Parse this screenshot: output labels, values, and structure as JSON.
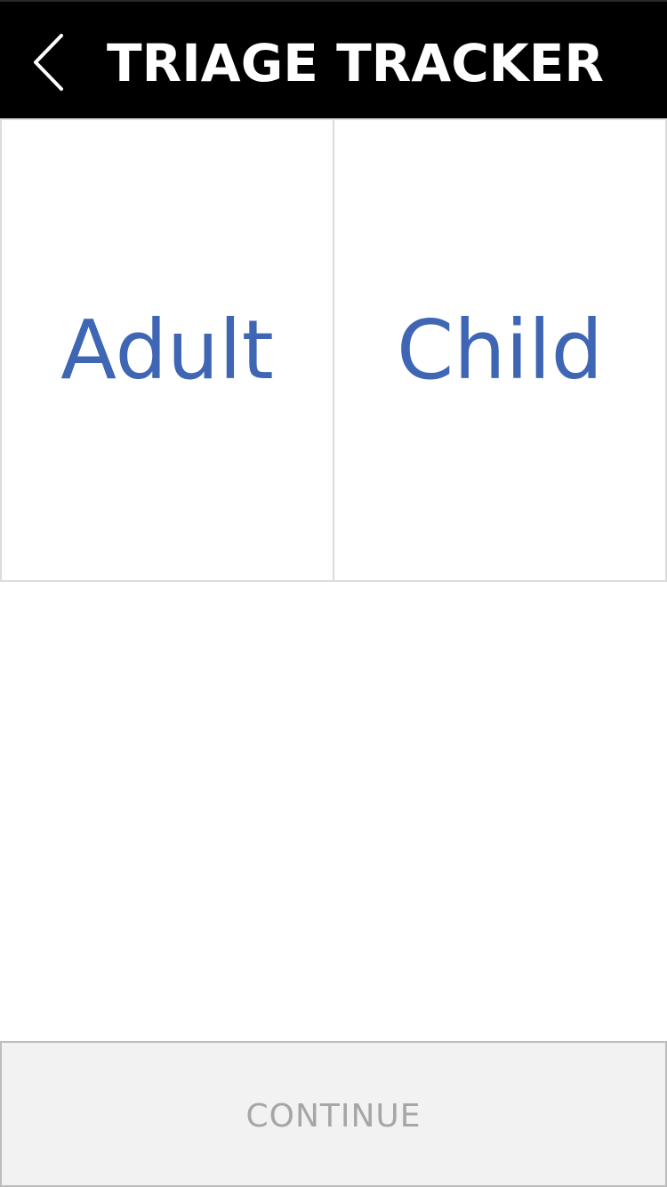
{
  "header": {
    "title": "TRIAGE TRACKER",
    "back_icon": "chevron-left-icon",
    "background": "#000000",
    "title_color": "#ffffff"
  },
  "options": [
    {
      "label": "Adult"
    },
    {
      "label": "Child"
    }
  ],
  "option_text_color": "#3f66b4",
  "footer": {
    "continue_label": "CONTINUE",
    "disabled": true
  }
}
